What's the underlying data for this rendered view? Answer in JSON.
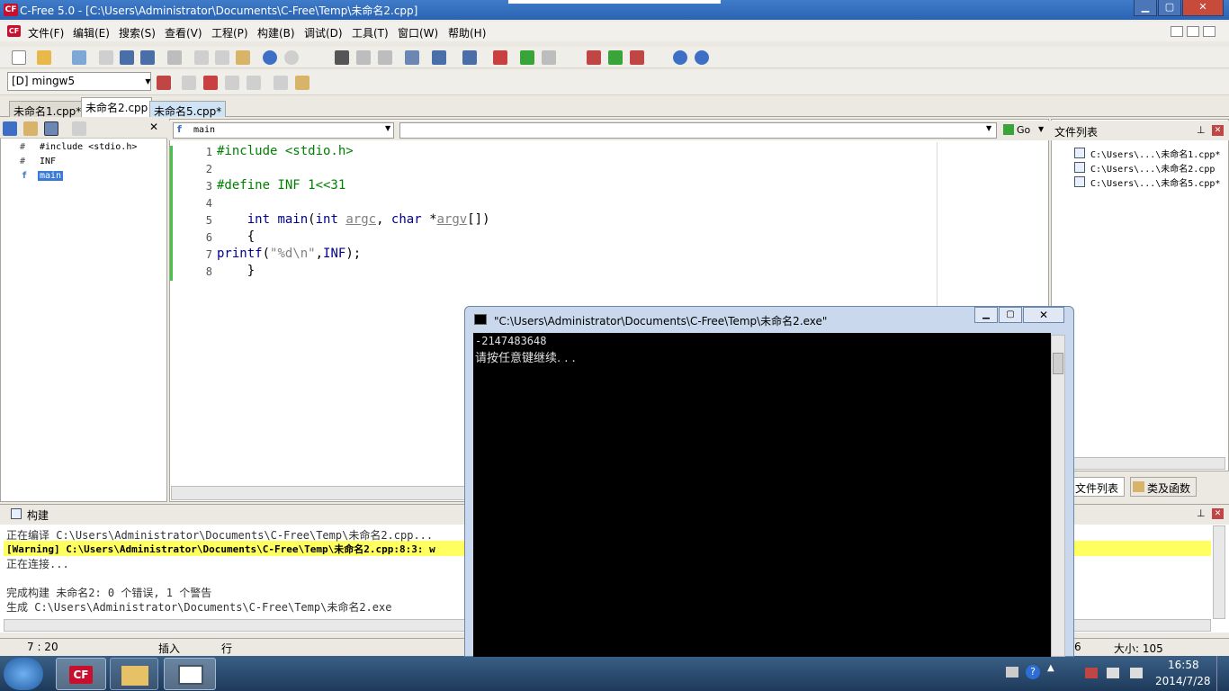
{
  "window": {
    "title": "C-Free 5.0 - [C:\\Users\\Administrator\\Documents\\C-Free\\Temp\\未命名2.cpp]",
    "minimize": "▁",
    "maximize": "▢",
    "close": "✕"
  },
  "menu": [
    "文件(F)",
    "编辑(E)",
    "搜索(S)",
    "查看(V)",
    "工程(P)",
    "构建(B)",
    "调试(D)",
    "工具(T)",
    "窗口(W)",
    "帮助(H)"
  ],
  "compiler_combo": "[D] mingw5",
  "tabs": [
    "未命名1.cpp*",
    "未命名2.cpp",
    "未命名5.cpp*"
  ],
  "outline": [
    {
      "icon": "#",
      "label": "#include <stdio.h>"
    },
    {
      "icon": "#",
      "label": "INF"
    },
    {
      "icon": "f",
      "label": "main"
    }
  ],
  "function_selector": "main",
  "go_label": "Go",
  "code_lines": [
    "1",
    "2",
    "3",
    "4",
    "5",
    "6",
    "7",
    "8"
  ],
  "right_panel": {
    "title": "文件列表",
    "files": [
      "C:\\Users\\...\\未命名1.cpp*",
      "C:\\Users\\...\\未命名2.cpp",
      "C:\\Users\\...\\未命名5.cpp*"
    ],
    "tab_files": "文件列表",
    "tab_classes": "类及函数"
  },
  "build": {
    "title": "构建",
    "lines": [
      "正在编译 C:\\Users\\Administrator\\Documents\\C-Free\\Temp\\未命名2.cpp...",
      "[Warning] C:\\Users\\Administrator\\Documents\\C-Free\\Temp\\未命名2.cpp:8:3: w",
      "正在连接...",
      "",
      "完成构建 未命名2: 0 个错误, 1 个警告",
      "生成 C:\\Users\\Administrator\\Documents\\C-Free\\Temp\\未命名2.exe"
    ]
  },
  "status": {
    "pos": "7 : 20",
    "mode": "插入",
    "line": "行",
    "col_frag": "6",
    "size": "大小: 105"
  },
  "console": {
    "title": "\"C:\\Users\\Administrator\\Documents\\C-Free\\Temp\\未命名2.exe\"",
    "output": [
      "-2147483648",
      "请按任意键继续. . ."
    ]
  },
  "clock": {
    "time": "16:58",
    "date": "2014/7/28"
  }
}
